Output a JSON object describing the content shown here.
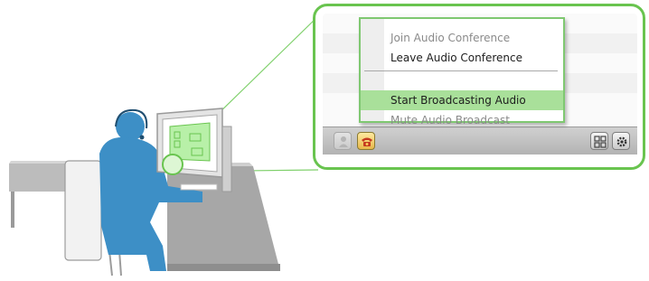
{
  "menu": {
    "items": [
      {
        "label": "Join Audio Conference",
        "state": "disabled"
      },
      {
        "label": "Leave Audio Conference",
        "state": "enabled"
      },
      {
        "label": "Start Broadcasting Audio",
        "state": "highlighted"
      },
      {
        "label": "Mute Audio Broadcast",
        "state": "disabled"
      }
    ]
  },
  "toolbar": {
    "left_buttons": [
      "user-icon",
      "phone-icon"
    ],
    "right_buttons": [
      "layout-icon",
      "gear-icon"
    ]
  },
  "colors": {
    "accent_green": "#69c44f",
    "highlight": "#a9e09a",
    "person_blue": "#3d8fc6",
    "desk_gray": "#a3a3a3"
  }
}
